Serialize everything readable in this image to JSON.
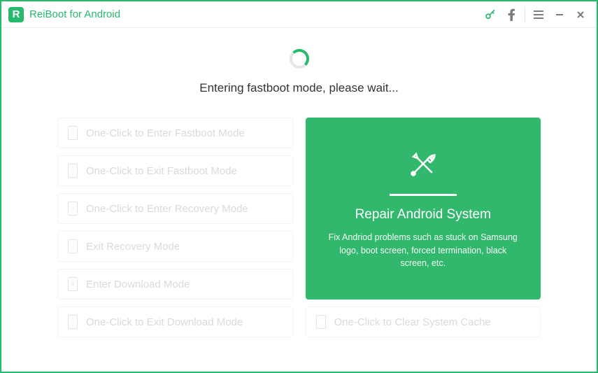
{
  "app": {
    "title": "ReiBoot for Android",
    "logo_letter": "R"
  },
  "status": "Entering fastboot mode, please wait...",
  "modes": {
    "enter_fastboot": {
      "label": "One-Click to Enter Fastboot Mode",
      "glyph": "↑"
    },
    "exit_fastboot": {
      "label": "One-Click to Exit Fastboot Mode",
      "glyph": "↓"
    },
    "enter_recovery": {
      "label": "One-Click to Enter Recovery Mode",
      "glyph": "↑"
    },
    "exit_recovery": {
      "label": "Exit Recovery Mode",
      "glyph": "↓"
    },
    "enter_download": {
      "label": "Enter Download Mode",
      "glyph": "⭳"
    },
    "exit_download": {
      "label": "One-Click to Exit Download Mode",
      "glyph": "↓"
    },
    "clear_cache": {
      "label": "One-Click to Clear System Cache",
      "glyph": ""
    }
  },
  "repair": {
    "title": "Repair Android System",
    "description": "Fix Andriod problems such as stuck on Samsung logo, boot screen, forced termination, black screen, etc."
  },
  "colors": {
    "accent": "#27b96c"
  }
}
